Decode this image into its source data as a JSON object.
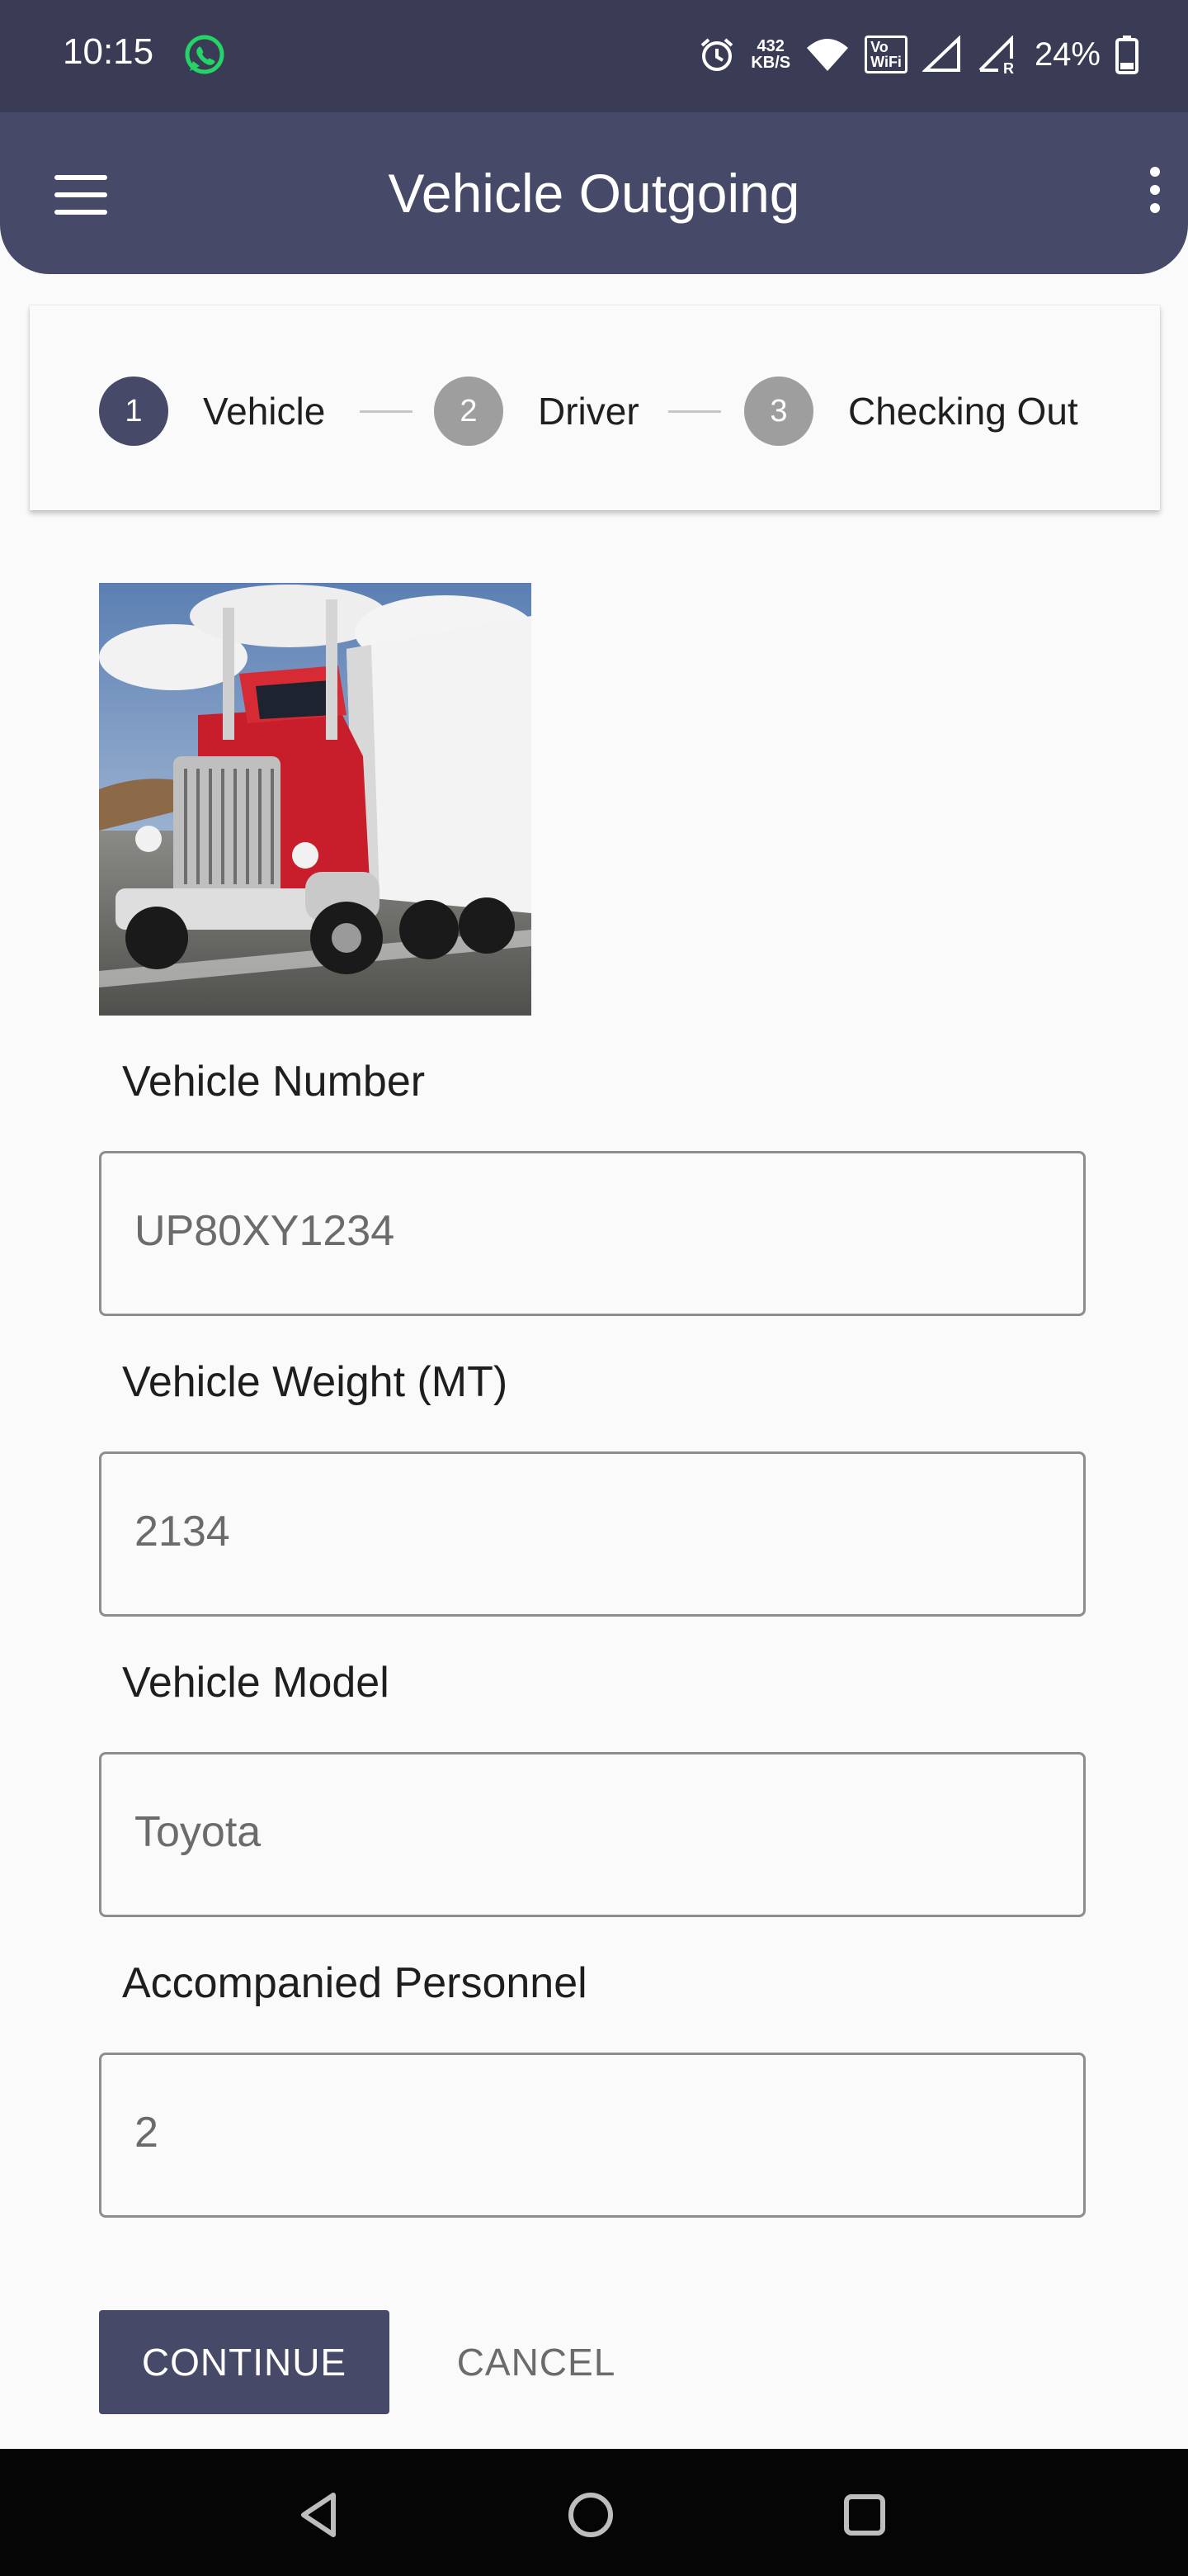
{
  "status_bar": {
    "time": "10:15",
    "net_speed_value": "432",
    "net_speed_unit": "KB/S",
    "vowifi_top": "Vo",
    "vowifi_bottom": "WiFi",
    "battery": "24%"
  },
  "app_bar": {
    "title": "Vehicle Outgoing"
  },
  "stepper": {
    "steps": [
      {
        "number": "1",
        "label": "Vehicle",
        "active": true
      },
      {
        "number": "2",
        "label": "Driver",
        "active": false
      },
      {
        "number": "3",
        "label": "Checking Out",
        "active": false
      }
    ]
  },
  "form": {
    "vehicle_number": {
      "label": "Vehicle Number",
      "value": "UP80XY1234"
    },
    "vehicle_weight": {
      "label": "Vehicle Weight (MT)",
      "value": "2134"
    },
    "vehicle_model": {
      "label": "Vehicle Model",
      "value": "Toyota"
    },
    "accompanied_personnel": {
      "label": "Accompanied Personnel",
      "value": "2"
    }
  },
  "actions": {
    "continue_label": "CONTINUE",
    "cancel_label": "CANCEL"
  },
  "colors": {
    "primary": "#474968",
    "status_bar": "#3a3b55",
    "step_inactive": "#9e9e9e",
    "whatsapp": "#25d366"
  }
}
